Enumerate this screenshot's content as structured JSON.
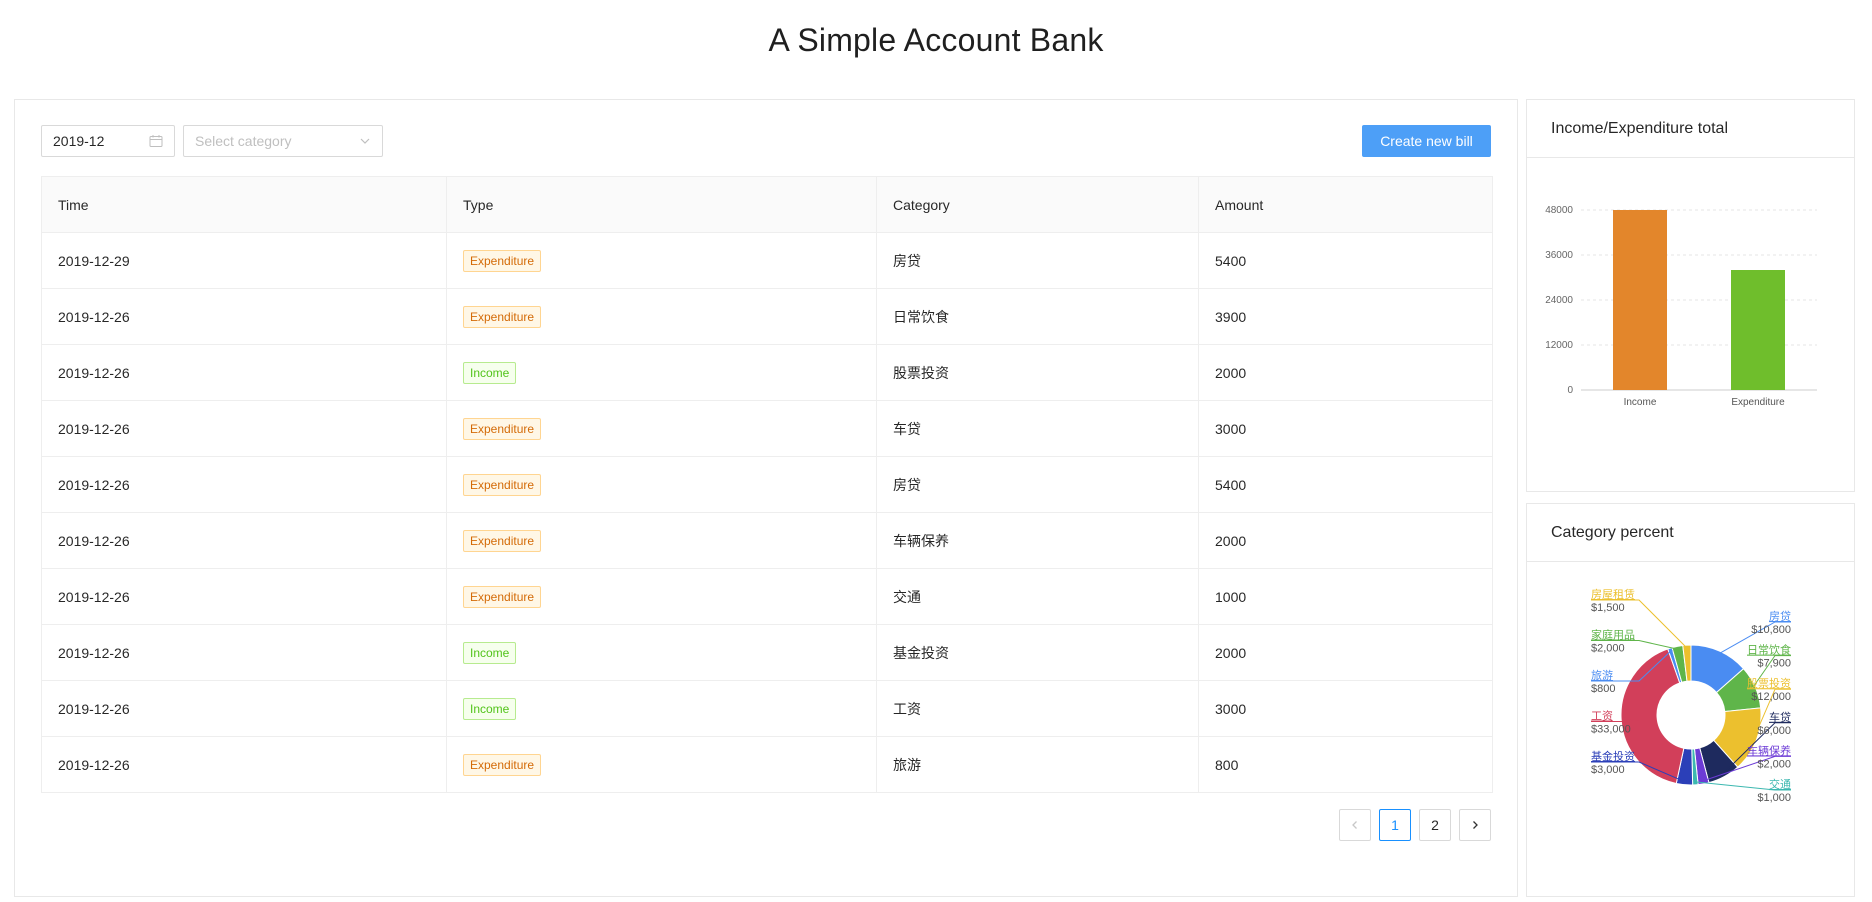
{
  "app": {
    "title": "A Simple Account Bank"
  },
  "toolbar": {
    "month_value": "2019-12",
    "category_placeholder": "Select category",
    "create_label": "Create new bill"
  },
  "table": {
    "headers": [
      "Time",
      "Type",
      "Category",
      "Amount"
    ],
    "rows": [
      {
        "time": "2019-12-29",
        "type": "Expenditure",
        "category": "房贷",
        "amount": "5400"
      },
      {
        "time": "2019-12-26",
        "type": "Expenditure",
        "category": "日常饮食",
        "amount": "3900"
      },
      {
        "time": "2019-12-26",
        "type": "Income",
        "category": "股票投资",
        "amount": "2000"
      },
      {
        "time": "2019-12-26",
        "type": "Expenditure",
        "category": "车贷",
        "amount": "3000"
      },
      {
        "time": "2019-12-26",
        "type": "Expenditure",
        "category": "房贷",
        "amount": "5400"
      },
      {
        "time": "2019-12-26",
        "type": "Expenditure",
        "category": "车辆保养",
        "amount": "2000"
      },
      {
        "time": "2019-12-26",
        "type": "Expenditure",
        "category": "交通",
        "amount": "1000"
      },
      {
        "time": "2019-12-26",
        "type": "Income",
        "category": "基金投资",
        "amount": "2000"
      },
      {
        "time": "2019-12-26",
        "type": "Income",
        "category": "工资",
        "amount": "3000"
      },
      {
        "time": "2019-12-26",
        "type": "Expenditure",
        "category": "旅游",
        "amount": "800"
      }
    ]
  },
  "pagination": {
    "pages": [
      "1",
      "2"
    ],
    "current": "1",
    "prev_icon": "chevron-left-icon",
    "next_icon": "chevron-right-icon"
  },
  "bar_card": {
    "title": "Income/Expenditure total"
  },
  "pie_card": {
    "title": "Category percent"
  },
  "chart_data": [
    {
      "type": "bar",
      "title": "Income/Expenditure total",
      "categories": [
        "Income",
        "Expenditure"
      ],
      "values": [
        48000,
        32000
      ],
      "colors": [
        "#e3862b",
        "#6fbe2c"
      ],
      "ylim": [
        0,
        48000
      ],
      "yticks": [
        "0",
        "12000",
        "24000",
        "36000",
        "48000"
      ],
      "grid": true
    },
    {
      "type": "pie",
      "title": "Category percent",
      "donut": true,
      "slices": [
        {
          "label": "房贷",
          "value": 10800,
          "value_label": "$10,800",
          "color": "#4a8cf2"
        },
        {
          "label": "日常饮食",
          "value": 7900,
          "value_label": "$7,900",
          "color": "#5fb54a"
        },
        {
          "label": "股票投资",
          "value": 12000,
          "value_label": "$12,000",
          "color": "#ecc02e"
        },
        {
          "label": "车贷",
          "value": 6000,
          "value_label": "$6,000",
          "color": "#1e2a5e"
        },
        {
          "label": "车辆保养",
          "value": 2000,
          "value_label": "$2,000",
          "color": "#6c3bd6"
        },
        {
          "label": "交通",
          "value": 1000,
          "value_label": "$1,000",
          "color": "#3cb8b0"
        },
        {
          "label": "基金投资",
          "value": 3000,
          "value_label": "$3,000",
          "color": "#2b3fb8"
        },
        {
          "label": "工资",
          "value": 33000,
          "value_label": "$33,000",
          "color": "#d23f5a"
        },
        {
          "label": "旅游",
          "value": 800,
          "value_label": "$800",
          "color": "#4a8cf2"
        },
        {
          "label": "家庭用品",
          "value": 2000,
          "value_label": "$2,000",
          "color": "#5fb54a"
        },
        {
          "label": "房屋租赁",
          "value": 1500,
          "value_label": "$1,500",
          "color": "#ecc02e"
        }
      ]
    }
  ]
}
